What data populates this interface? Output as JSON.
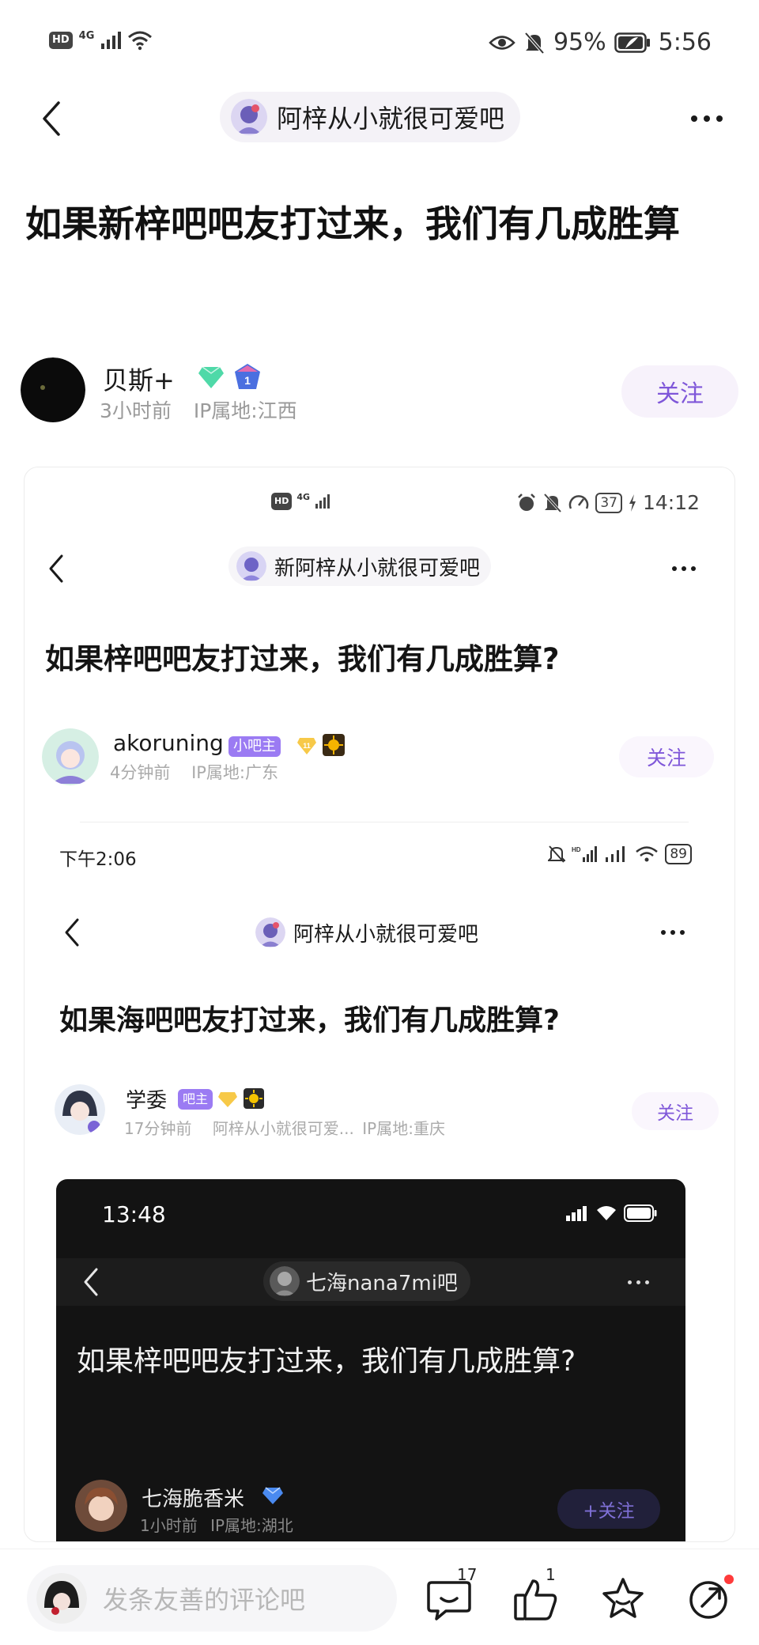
{
  "status_bar": {
    "network": "4G",
    "battery": "95%",
    "time": "5:56"
  },
  "nav": {
    "forum_name": "阿梓从小就很可爱吧"
  },
  "post": {
    "title": "如果新梓吧吧友打过来，我们有几成胜算",
    "author": {
      "name": "贝斯+",
      "level_badge": "1",
      "time": "3小时前",
      "location": "IP属地:江西"
    },
    "follow_label": "关注"
  },
  "screenshot_1": {
    "status": {
      "network": "4G",
      "battery": "37",
      "time": "14:12"
    },
    "forum_name": "新阿梓从小就很可爱吧",
    "title": "如果梓吧吧友打过来，我们有几成胜算?",
    "author": {
      "name": "akoruning",
      "role": "小吧主",
      "level_badge": "11",
      "time": "4分钟前",
      "location": "IP属地:广东"
    },
    "follow_label": "关注"
  },
  "screenshot_2": {
    "status": {
      "time": "下午2:06",
      "battery": "89"
    },
    "forum_name": "阿梓从小就很可爱吧",
    "title": "如果海吧吧友打过来，我们有几成胜算?",
    "author": {
      "name": "学委",
      "role": "吧主",
      "level_badge": "5",
      "time": "17分钟前",
      "forum_ref": "阿梓从小就很可爱...",
      "location": "IP属地:重庆"
    },
    "follow_label": "关注"
  },
  "screenshot_3": {
    "status": {
      "time": "13:48"
    },
    "forum_name": "七海nana7mi吧",
    "title": "如果梓吧吧友打过来，我们有几成胜算?",
    "author": {
      "name": "七海脆香米",
      "time": "1小时前",
      "location": "IP属地:湖北"
    },
    "follow_label": "+关注"
  },
  "bottom_bar": {
    "comment_placeholder": "发条友善的评论吧",
    "comments_count": "17",
    "likes_count": "1"
  },
  "colors": {
    "accent_purple": "#7f57d9",
    "follow_bg": "#f7f2fb",
    "dark_bg": "#131313"
  }
}
